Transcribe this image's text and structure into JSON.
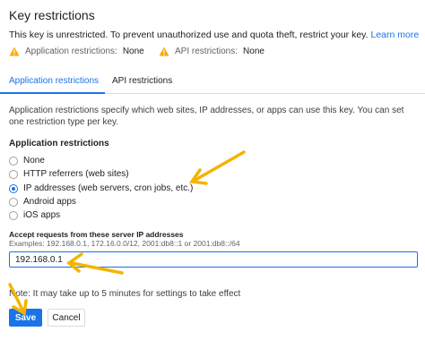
{
  "header": {
    "title": "Key restrictions",
    "warning_text": "This key is unrestricted. To prevent unauthorized use and quota theft, restrict your key.",
    "learn_more": "Learn more"
  },
  "status": {
    "app_label": "Application restrictions:",
    "app_value": "None",
    "api_label": "API restrictions:",
    "api_value": "None"
  },
  "tabs": [
    {
      "label": "Application restrictions",
      "active": true
    },
    {
      "label": "API restrictions",
      "active": false
    }
  ],
  "description": "Application restrictions specify which web sites, IP addresses, or apps can use this key. You can set one restriction type per key.",
  "restrictions": {
    "title": "Application restrictions",
    "options": [
      {
        "label": "None",
        "checked": false
      },
      {
        "label": "HTTP referrers (web sites)",
        "checked": false
      },
      {
        "label": "IP addresses (web servers, cron jobs, etc.)",
        "checked": true
      },
      {
        "label": "Android apps",
        "checked": false
      },
      {
        "label": "iOS apps",
        "checked": false
      }
    ]
  },
  "ip_section": {
    "label": "Accept requests from these server IP addresses",
    "examples": "Examples: 192.168.0.1, 172.16.0.0/12, 2001:db8::1 or 2001:db8::/64",
    "value": "192.168.0.1"
  },
  "note": "Note: It may take up to 5 minutes for settings to take effect",
  "buttons": {
    "save": "Save",
    "cancel": "Cancel"
  },
  "colors": {
    "accent": "#1a73e8",
    "warning": "#f9ab00",
    "arrow": "#f4b400"
  }
}
